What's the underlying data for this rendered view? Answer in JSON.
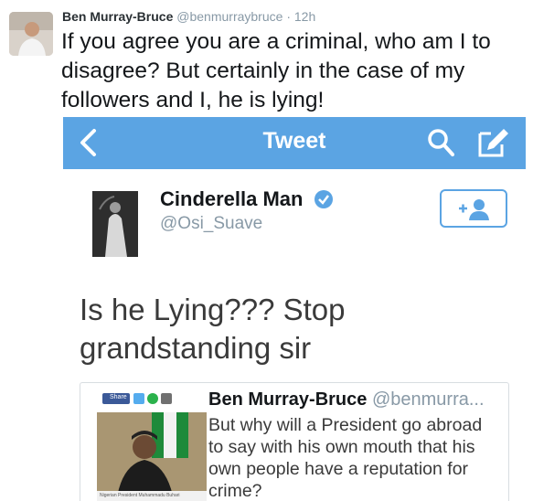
{
  "tweet": {
    "author_name": "Ben Murray-Bruce",
    "author_handle": "@benmurraybruce",
    "separator": "·",
    "time": "12h",
    "text": "If you agree you are a criminal, who am I to disagree? But certainly in the case of my followers and I, he is lying!"
  },
  "embedded": {
    "nav_title": "Tweet",
    "nav_color": "#5ba4e3",
    "icons": [
      "chevron-left-icon",
      "search-icon",
      "compose-icon"
    ],
    "author_name": "Cinderella Man",
    "author_handle": "@Osi_Suave",
    "verified": true,
    "follow_icon": "add-user-icon",
    "text": "Is he Lying??? Stop grandstanding sir",
    "quote": {
      "share_label": "Share",
      "author_name": "Ben Murray-Bruce",
      "author_handle": "@benmurra...",
      "text": "But why will a President go abroad to say with his own mouth that his own people have a reputation for crime?",
      "photo_caption": "Nigerian President Muhammadu Buhari"
    }
  }
}
